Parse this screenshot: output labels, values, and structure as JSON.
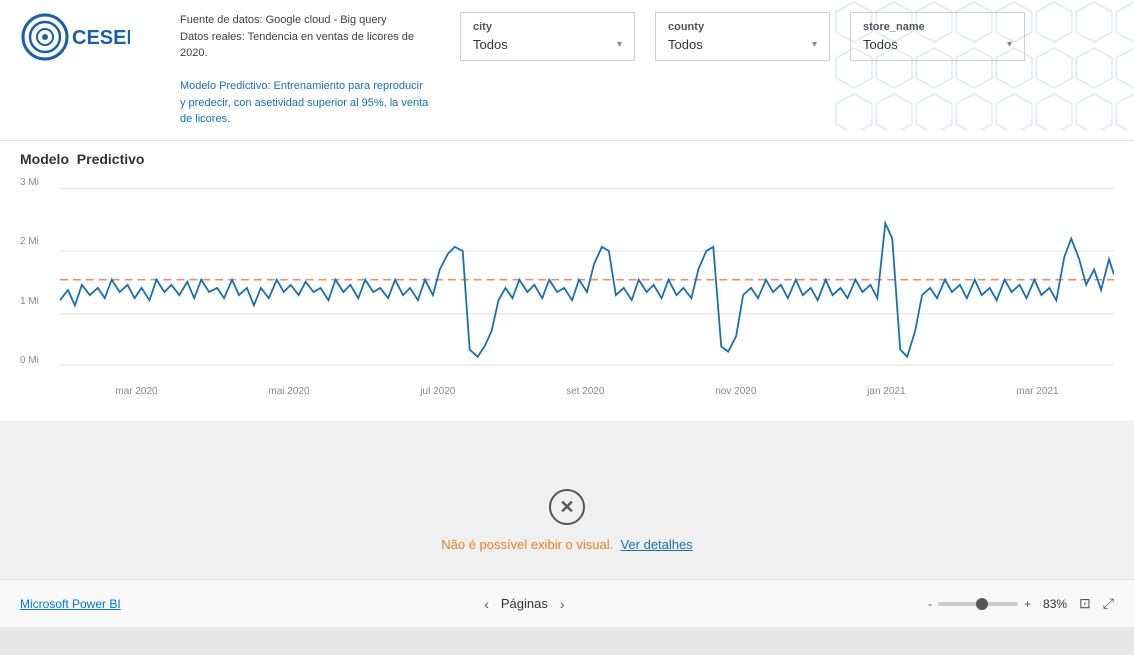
{
  "header": {
    "logo_text": "CESEM",
    "info_line1": "Fuente de datos: Google cloud - Big query",
    "info_line2": "Datos reales: Tendencia en ventas de licores de 2020.",
    "info_line3": "Modelo Predictivo: Entrenamiento para reproducir y predecir, con asetividad superior al 95%, la venta de licores."
  },
  "filters": {
    "city": {
      "label": "city",
      "value": "Todos",
      "chevron": "▾"
    },
    "county": {
      "label": "county",
      "value": "Todos",
      "chevron": "▾"
    },
    "store_name": {
      "label": "store_name",
      "value": "Todos",
      "chevron": "▾"
    }
  },
  "chart": {
    "title_prefix": "Modelo",
    "title_bold": "Predictivo",
    "y_labels": [
      "3 Mi",
      "2 Mi",
      "1 Mi",
      "0 Mi"
    ],
    "x_labels": [
      "mar 2020",
      "mai 2020",
      "jul 2020",
      "set 2020",
      "nov 2020",
      "jan 2021",
      "mar 2021"
    ]
  },
  "error_panel": {
    "icon": "✕",
    "message_prefix": "Não é possível exibir o visual.",
    "link_text": "Ver detalhes"
  },
  "bottom_bar": {
    "powerbi_link": "Microsoft Power BI",
    "pages_label": "Páginas",
    "prev_arrow": "‹",
    "next_arrow": "›",
    "zoom_minus": "-",
    "zoom_plus": "+",
    "zoom_value": "83%"
  }
}
